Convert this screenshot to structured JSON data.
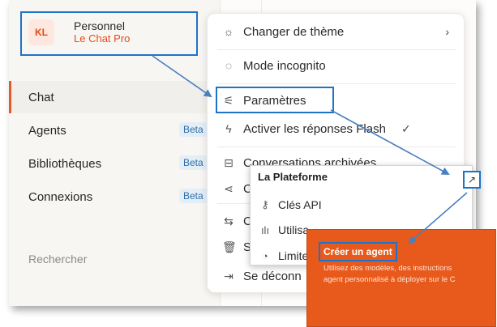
{
  "profile": {
    "initials": "KL",
    "name": "Personnel",
    "plan": "Le Chat Pro"
  },
  "sidebar": {
    "items": [
      {
        "label": "Chat",
        "badge": ""
      },
      {
        "label": "Agents",
        "badge": "Beta"
      },
      {
        "label": "Bibliothèques",
        "badge": "Beta"
      },
      {
        "label": "Connexions",
        "badge": "Beta"
      }
    ],
    "search_label": "Rechercher"
  },
  "menu": {
    "theme": "Changer de thème",
    "incognito": "Mode incognito",
    "settings": "Paramètres",
    "flash": "Activer les réponses Flash",
    "archived": "Conversations archivées",
    "share_partial": "C",
    "switch_partial": "C",
    "delete_partial": "S",
    "logout": "Se déconn"
  },
  "plateforme": {
    "title": "La Plateforme",
    "api_keys": "Clés API",
    "usage": "Utilisa",
    "limits": "Limite"
  },
  "agent_card": {
    "title": "Créer un agent",
    "desc_line1": "Utilisez des modèles, des instructions",
    "desc_line2": "agent personnalisé à déployer sur le C"
  },
  "colors": {
    "accent": "#e34b1c",
    "highlight": "#1e72c7",
    "agent_bg": "#e85a1b"
  }
}
